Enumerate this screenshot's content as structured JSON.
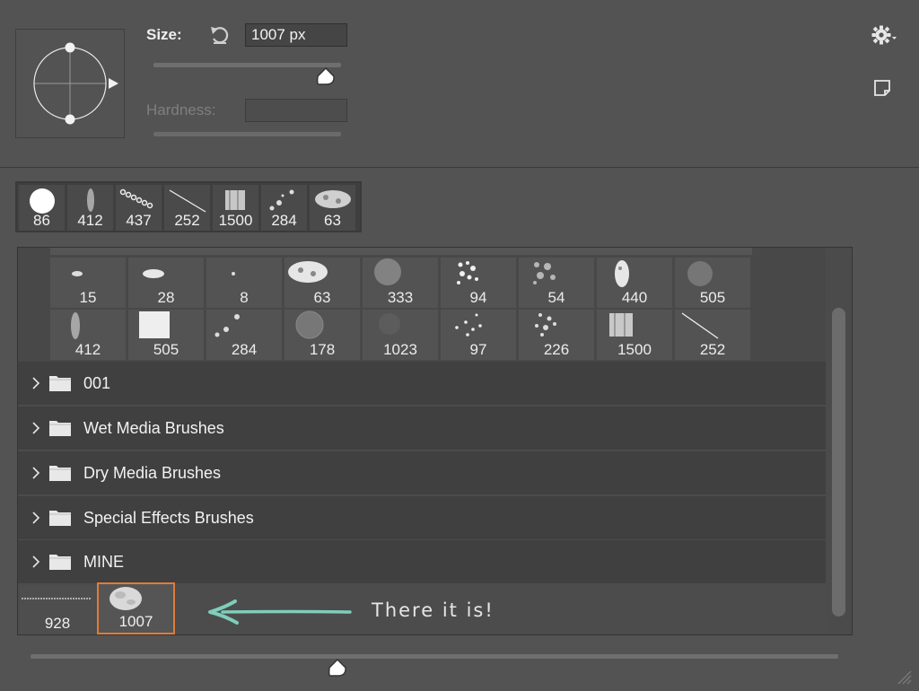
{
  "settings": {
    "size_label": "Size:",
    "size_value": "1007 px",
    "size_slider_fraction": 0.9,
    "hardness_label": "Hardness:",
    "hardness_value": ""
  },
  "icons": {
    "reset": "reset-icon",
    "gear": "gear-icon",
    "new_preset": "new-preset-icon",
    "folder": "folder-icon",
    "chevron": "chevron-right-icon",
    "grip": "resize-grip-icon"
  },
  "recent_brushes": [
    {
      "value": "86"
    },
    {
      "value": "412"
    },
    {
      "value": "437"
    },
    {
      "value": "252"
    },
    {
      "value": "1500"
    },
    {
      "value": "284"
    },
    {
      "value": "63"
    }
  ],
  "brush_grid": {
    "rows": [
      [
        "15",
        "28",
        "8",
        "63",
        "333",
        "94",
        "54",
        "440",
        "505"
      ],
      [
        "412",
        "505",
        "284",
        "178",
        "1023",
        "97",
        "226",
        "1500",
        "252"
      ]
    ]
  },
  "groups": [
    {
      "name": "001"
    },
    {
      "name": "Wet Media Brushes"
    },
    {
      "name": "Dry Media Brushes"
    },
    {
      "name": "Special Effects Brushes"
    },
    {
      "name": "MINE"
    }
  ],
  "mine_brushes": [
    {
      "value": "928"
    },
    {
      "value": "1007",
      "selected": true
    }
  ],
  "annotation": {
    "text": "There it is!",
    "color": "#7fcdbb"
  },
  "colors": {
    "selection_border": "#e07b39",
    "panel_bg": "#535353"
  }
}
